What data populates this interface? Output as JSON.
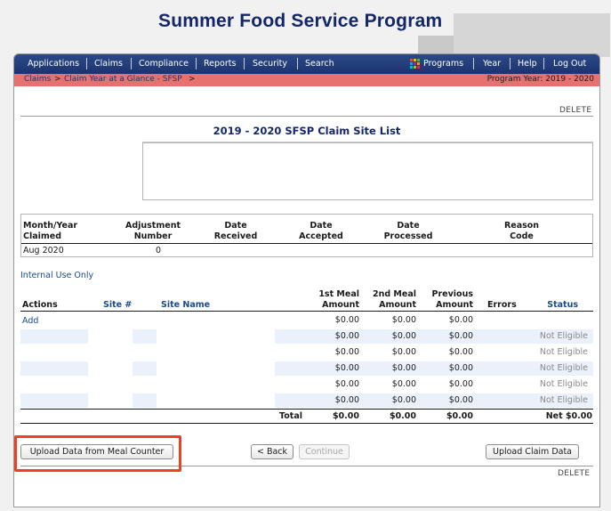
{
  "app": {
    "title": "Summer Food Service Program"
  },
  "nav": {
    "items": [
      "Applications",
      "Claims",
      "Compliance",
      "Reports",
      "Security",
      "Search"
    ],
    "programs": "Programs",
    "year": "Year",
    "help": "Help",
    "logout": "Log Out"
  },
  "breadcrumb": {
    "claims": "Claims",
    "separator": ">",
    "claim_year": "Claim Year at a Glance - SFSP",
    "trail_end": ">"
  },
  "program_year": "Program Year: 2019 - 2020",
  "delete_label": "DELETE",
  "page_title": "2019 - 2020 SFSP Claim Site List",
  "claim_info": {
    "headers": {
      "month_year": [
        "Month/Year",
        "Claimed"
      ],
      "adjustment": [
        "Adjustment",
        "Number"
      ],
      "date_received": [
        "Date",
        "Received"
      ],
      "date_accepted": [
        "Date",
        "Accepted"
      ],
      "date_processed": [
        "Date",
        "Processed"
      ],
      "reason_code": [
        "Reason",
        "Code"
      ]
    },
    "row": {
      "month_year": "Aug 2020",
      "adjustment": "0"
    }
  },
  "internal_use": "Internal Use Only",
  "sites": {
    "headers": {
      "actions": "Actions",
      "site_num": "Site #",
      "site_name": "Site Name",
      "first_meal": [
        "1st Meal",
        "Amount"
      ],
      "second_meal": [
        "2nd Meal",
        "Amount"
      ],
      "previous": [
        "Previous",
        "Amount"
      ],
      "errors": "Errors",
      "status": "Status"
    },
    "add_label": "Add",
    "rows": [
      {
        "first": "$0.00",
        "second": "$0.00",
        "previous": "$0.00",
        "status": ""
      },
      {
        "first": "$0.00",
        "second": "$0.00",
        "previous": "$0.00",
        "status": "Not Eligible"
      },
      {
        "first": "$0.00",
        "second": "$0.00",
        "previous": "$0.00",
        "status": "Not Eligible"
      },
      {
        "first": "$0.00",
        "second": "$0.00",
        "previous": "$0.00",
        "status": "Not Eligible"
      },
      {
        "first": "$0.00",
        "second": "$0.00",
        "previous": "$0.00",
        "status": "Not Eligible"
      },
      {
        "first": "$0.00",
        "second": "$0.00",
        "previous": "$0.00",
        "status": "Not Eligible"
      }
    ],
    "total": {
      "label": "Total",
      "first": "$0.00",
      "second": "$0.00",
      "previous": "$0.00",
      "net": "Net $0.00"
    }
  },
  "buttons": {
    "upload_meal_counter": "Upload Data from Meal Counter",
    "back": "< Back",
    "continue": "Continue",
    "upload_claim": "Upload Claim Data"
  },
  "colors": {
    "navbar": "#1b3470",
    "breadcrumb_bar": "#e6726f",
    "highlight": "#f2401e",
    "title": "#14276b"
  }
}
